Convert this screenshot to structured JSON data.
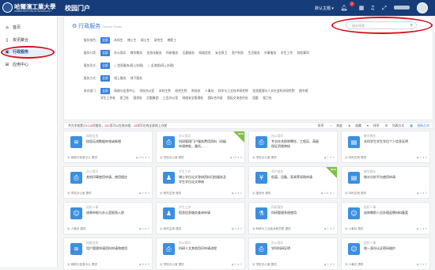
{
  "header": {
    "logo_text": "哈爾濱工業大學",
    "logo_subtitle": "HARBIN INSTITUTE OF TECHNOLOGY",
    "portal_title": "校园门户",
    "theme_label": "默认主题",
    "notification_count": "2",
    "colors": {
      "bar": "#163c7a",
      "accent": "#3b7ee3",
      "badge": "#e8393b"
    }
  },
  "sidebar": {
    "items": [
      {
        "label": "首页",
        "icon": "home-icon"
      },
      {
        "label": "资讯聚合",
        "icon": "document-icon"
      },
      {
        "label": "行政服务",
        "icon": "briefcase-icon"
      },
      {
        "label": "应用中心",
        "icon": "grid-icon"
      }
    ],
    "active_index": 2
  },
  "panel": {
    "title": "行政服务",
    "title_en": "Service Center",
    "search_placeholder": "服务搜索"
  },
  "filters": [
    {
      "label": "服务角色:",
      "options": [
        "全部",
        "本科生",
        "博士生",
        "硕士生",
        "研究生",
        "教职工"
      ],
      "type": "chip"
    },
    {
      "label": "服务分类:",
      "options": [
        "全部",
        "办公用印",
        "教学教务",
        "信息化服务",
        "科研服务",
        "后勤服务",
        "网络信息",
        "安全保卫",
        "资产财务",
        "生活服务",
        "外事服务",
        "学生工作",
        "其他事项"
      ],
      "type": "chip"
    },
    {
      "label": "服务形式:",
      "options": [
        "全部",
        "信息服务(网上办理)",
        "全流程(网上办理)"
      ],
      "type": "radio"
    },
    {
      "label": "服务方式:",
      "options": [
        "全部",
        "线上服务",
        "线下服务"
      ],
      "type": "chip"
    },
    {
      "label": "承办部门:",
      "options": [
        "全部",
        "网络与信息中心",
        "学校办公室",
        "本科生院",
        "研究生院",
        "财务处",
        "人事处",
        "科学与工业技术研究院",
        "信息管理与人文社会科学研究院",
        "图书馆"
      ],
      "type": "chip"
    },
    {
      "label": "",
      "options": [
        "学生工作处",
        "保卫处",
        "国资处",
        "后勤集团",
        "工会办公室",
        "网络安全管理处",
        "国际合作部",
        "国际交流合作处",
        "团委",
        "保卫处"
      ],
      "type": "chip"
    }
  ],
  "status": {
    "prefix": "共为学校累计",
    "total": "1148",
    "middle": "项服务，",
    "online": "284",
    "middle2": "项可以在线办理，",
    "done": "28",
    "suffix": "项可在线全部线上办理",
    "sort_options": [
      "排序:",
      "热度",
      "收藏",
      "排序",
      "列表方式",
      "图标方式"
    ]
  },
  "cards": [
    {
      "category": "网络信息",
      "name": "校园无线数据申领或新增",
      "name2": "",
      "dept": "网络与信息中心  提供",
      "views": "234",
      "stars": "3",
      "icon": "wifi-icon",
      "color": "#3b8fe0",
      "tag": ""
    },
    {
      "category": "办公用印",
      "name": "科研管理门户服务费用资料（初级",
      "name2": "申请审批，委托，…",
      "dept": "学校办公室  提供",
      "views": "15",
      "stars": "0",
      "icon": "stamp-icon",
      "color": "#3b8fe0",
      "tag": "NEW"
    },
    {
      "category": "办公用印",
      "name": "专业技术职称聘任、工程证、高级",
      "name2": "保证资格审核",
      "dept": "学校办公室  提供",
      "views": "1",
      "stars": "0",
      "icon": "stamp-icon",
      "color": "#3b8fe0",
      "tag": ""
    },
    {
      "category": "教学教务",
      "name": "本科学生学生学位个人信息证明",
      "name2": "",
      "dept": "本科生院  提供",
      "views": "1",
      "stars": "0",
      "icon": "book-icon",
      "color": "#3b8fe0",
      "tag": ""
    },
    {
      "category": "办公用印",
      "name": "其他印章使用申请，使用相应",
      "name2": "",
      "dept": "学校办公室  提供",
      "views": "9",
      "stars": "0",
      "icon": "stamp-icon",
      "color": "#3b8fe0",
      "tag": ""
    },
    {
      "category": "学生工作",
      "name": "博士学位论文答辩资料归档服务及",
      "name2": "学生学位论文审核",
      "dept": "研究生院  提供",
      "views": "8",
      "stars": "0",
      "icon": "student-icon",
      "color": "#3b8fe0",
      "tag": ""
    },
    {
      "category": "资产财务",
      "name": "低值、设备、家具等采购申请",
      "name2": "",
      "dept": "国资处  提供",
      "views": "141",
      "stars": "1",
      "icon": "money-icon",
      "color": "#3b8fe0",
      "tag": "NEW"
    },
    {
      "category": "教学教务",
      "name": "统计分析平台使用申请",
      "name2": "",
      "dept": "本科生院  提供",
      "views": "1",
      "stars": "0",
      "icon": "book-icon",
      "color": "#3b8fe0",
      "tag": ""
    },
    {
      "category": "组织人事",
      "name": "成果申报与办公室报到入职",
      "name2": "",
      "dept": "人事处  提供",
      "views": "4",
      "stars": "0",
      "icon": "person-icon",
      "color": "#3b8fe0",
      "tag": ""
    },
    {
      "category": "学生工作",
      "name": "宿舍信息服务查询申请",
      "name2": "",
      "dept": "研究生院  提供",
      "views": "4",
      "stars": "0",
      "icon": "student-icon",
      "color": "#3b8fe0",
      "tag": ""
    },
    {
      "category": "科研服务",
      "name": "科研管理系统使用",
      "name2": "",
      "dept": "科研与工业技术研究院  提供",
      "views": "1",
      "stars": "0",
      "icon": "flask-icon",
      "color": "#3b8fe0",
      "tag": ""
    },
    {
      "category": "组织人事",
      "name": "退休教职人员办理返聘材料备案",
      "name2": "",
      "dept": "人事处  提供",
      "views": "1",
      "stars": "0",
      "icon": "person-icon",
      "color": "#3b8fe0",
      "tag": ""
    },
    {
      "category": "网络信息",
      "name": "用户管理申请资料申请和使用",
      "name2": "",
      "dept": "网络与信息中心  提供",
      "views": "8",
      "stars": "0",
      "icon": "wifi-icon",
      "color": "#3b8fe0",
      "tag": ""
    },
    {
      "category": "办公用印",
      "name": "科研人文其他用印申请流程",
      "name2": "",
      "dept": "学校办公室  提供",
      "views": "2",
      "stars": "0",
      "icon": "stamp-icon",
      "color": "#3b8fe0",
      "tag": ""
    },
    {
      "category": "办公用印",
      "name": "学科科研证明",
      "name2": "",
      "dept": "学校办公室  提供",
      "views": "1",
      "stars": "0",
      "icon": "stamp-icon",
      "color": "#3b8fe0",
      "tag": ""
    },
    {
      "category": "组织人事",
      "name": "统一身份认证密码维护",
      "name2": "",
      "dept": "人事处  提供",
      "views": "3",
      "stars": "0",
      "icon": "person-icon",
      "color": "#3b8fe0",
      "tag": ""
    }
  ]
}
